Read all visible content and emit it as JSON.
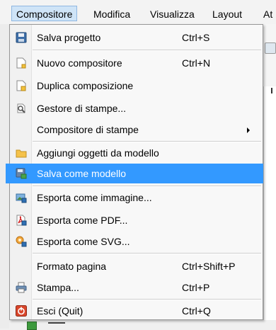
{
  "menubar": {
    "items": [
      {
        "label": "Compositore"
      },
      {
        "label": "Modifica"
      },
      {
        "label": "Visualizza"
      },
      {
        "label": "Layout"
      },
      {
        "label": "At"
      }
    ]
  },
  "menu": {
    "items": [
      {
        "label": "Salva progetto",
        "shortcut": "Ctrl+S",
        "icon": "save-icon"
      },
      {
        "label": "Nuovo compositore",
        "shortcut": "Ctrl+N",
        "icon": "new-composer-icon"
      },
      {
        "label": "Duplica composizione",
        "shortcut": "",
        "icon": "duplicate-composer-icon"
      },
      {
        "label": "Gestore di stampe...",
        "shortcut": "",
        "icon": "composer-manager-icon"
      },
      {
        "label": "Compositore di stampe",
        "shortcut": "",
        "icon": ""
      },
      {
        "label": "Aggiungi oggetti da modello",
        "shortcut": "",
        "icon": "folder-icon"
      },
      {
        "label": "Salva come modello",
        "shortcut": "",
        "icon": "save-as-template-icon"
      },
      {
        "label": "Esporta come immagine...",
        "shortcut": "",
        "icon": "export-image-icon"
      },
      {
        "label": "Esporta come PDF...",
        "shortcut": "",
        "icon": "export-pdf-icon"
      },
      {
        "label": "Esporta come SVG...",
        "shortcut": "",
        "icon": "export-svg-icon"
      },
      {
        "label": "Formato pagina",
        "shortcut": "Ctrl+Shift+P",
        "icon": ""
      },
      {
        "label": "Stampa...",
        "shortcut": "Ctrl+P",
        "icon": "printer-icon"
      },
      {
        "label": "Esci (Quit)",
        "shortcut": "Ctrl+Q",
        "icon": "quit-icon"
      }
    ]
  },
  "colors": {
    "highlight": "#3399ff",
    "menubar_active": "#cfe4f7"
  }
}
